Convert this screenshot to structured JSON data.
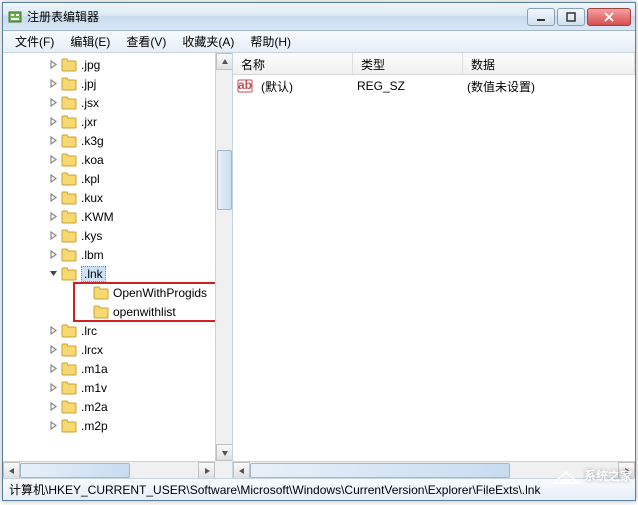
{
  "window": {
    "title": "注册表编辑器"
  },
  "menu": {
    "file": "文件(F)",
    "edit": "编辑(E)",
    "view": "查看(V)",
    "favorites": "收藏夹(A)",
    "help": "帮助(H)"
  },
  "tree": {
    "items": [
      {
        "label": ".jpg",
        "level": 2,
        "expandable": true
      },
      {
        "label": ".jpj",
        "level": 2,
        "expandable": true
      },
      {
        "label": ".jsx",
        "level": 2,
        "expandable": true
      },
      {
        "label": ".jxr",
        "level": 2,
        "expandable": true
      },
      {
        "label": ".k3g",
        "level": 2,
        "expandable": true
      },
      {
        "label": ".koa",
        "level": 2,
        "expandable": true
      },
      {
        "label": ".kpl",
        "level": 2,
        "expandable": true
      },
      {
        "label": ".kux",
        "level": 2,
        "expandable": true
      },
      {
        "label": ".KWM",
        "level": 2,
        "expandable": true
      },
      {
        "label": ".kys",
        "level": 2,
        "expandable": true
      },
      {
        "label": ".lbm",
        "level": 2,
        "expandable": true
      },
      {
        "label": ".lnk",
        "level": 2,
        "expandable": true,
        "expanded": true,
        "selected": true
      },
      {
        "label": "OpenWithProgids",
        "level": 3,
        "expandable": false,
        "highlighted": true
      },
      {
        "label": "openwithlist",
        "level": 3,
        "expandable": false,
        "highlighted": true
      },
      {
        "label": ".lrc",
        "level": 2,
        "expandable": true
      },
      {
        "label": ".lrcx",
        "level": 2,
        "expandable": true
      },
      {
        "label": ".m1a",
        "level": 2,
        "expandable": true
      },
      {
        "label": ".m1v",
        "level": 2,
        "expandable": true
      },
      {
        "label": ".m2a",
        "level": 2,
        "expandable": true
      },
      {
        "label": ".m2p",
        "level": 2,
        "expandable": true
      }
    ]
  },
  "list": {
    "columns": {
      "name": "名称",
      "type": "类型",
      "data": "数据"
    },
    "rows": [
      {
        "name": "(默认)",
        "type": "REG_SZ",
        "data": "(数值未设置)"
      }
    ]
  },
  "statusbar": {
    "path": "计算机\\HKEY_CURRENT_USER\\Software\\Microsoft\\Windows\\CurrentVersion\\Explorer\\FileExts\\.lnk"
  },
  "watermark": {
    "text": "系统之家"
  }
}
